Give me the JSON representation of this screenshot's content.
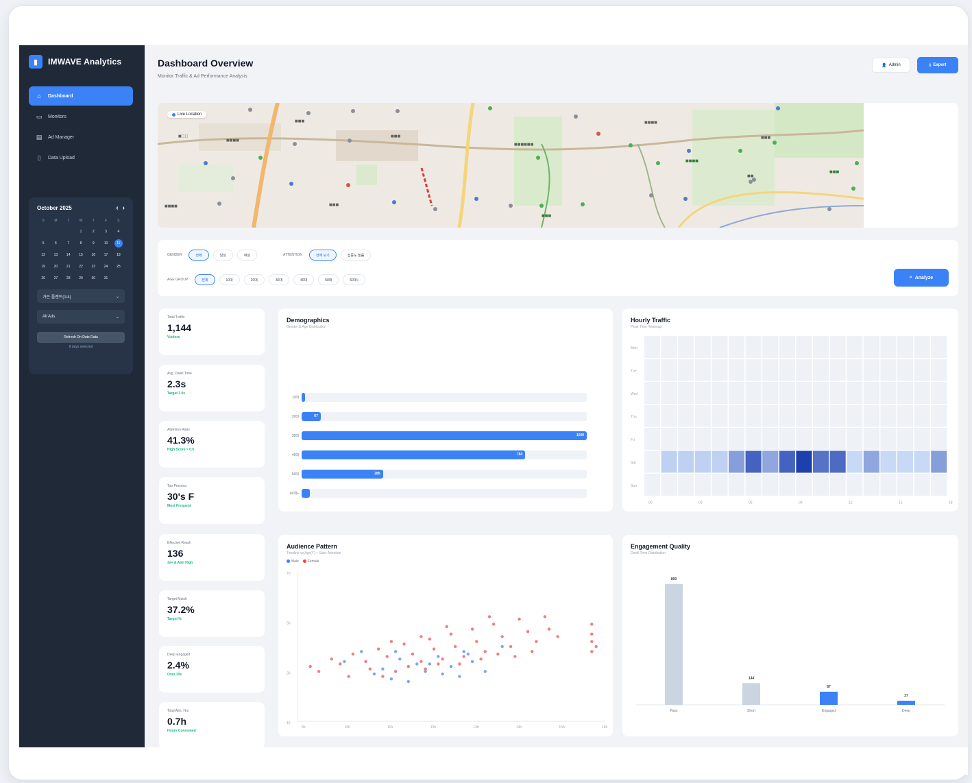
{
  "brand": {
    "name": "IMWAVE Analytics",
    "logo": "bar-chart-icon"
  },
  "nav": [
    {
      "label": "Dashboard",
      "icon": "home-icon",
      "active": true
    },
    {
      "label": "Monitors",
      "icon": "monitor-icon",
      "active": false
    },
    {
      "label": "Ad Manager",
      "icon": "ad-icon",
      "active": false
    },
    {
      "label": "Data Upload",
      "icon": "file-icon",
      "active": false
    }
  ],
  "calendar": {
    "month": "October 2025",
    "weekdays": [
      "S",
      "M",
      "T",
      "W",
      "T",
      "F",
      "S"
    ],
    "leading_blanks": 3,
    "days": 31,
    "selected_day": 11,
    "select1": "가든 플랜트(1/4)",
    "select2": "All Ads",
    "button": "Refresh On Date Data",
    "note": "8 days selected"
  },
  "header": {
    "title": "Dashboard Overview",
    "subtitle": "Monitor Traffic & Ad Performance Analysis",
    "admin": "Admin",
    "export": "Export"
  },
  "map": {
    "badge": "Live Location"
  },
  "filters": {
    "gender_label": "Gender",
    "gender": [
      {
        "label": "전체",
        "on": true
      },
      {
        "label": "남성",
        "on": false
      },
      {
        "label": "여성",
        "on": false
      }
    ],
    "attention_label": "Attention",
    "attention": [
      {
        "label": "전체 보기",
        "on": true
      },
      {
        "label": "집중도 높음",
        "on": false
      }
    ],
    "age_label": "Age Group",
    "age": [
      {
        "label": "전체",
        "on": true
      },
      {
        "label": "10대",
        "on": false
      },
      {
        "label": "20대",
        "on": false
      },
      {
        "label": "30대",
        "on": false
      },
      {
        "label": "40대",
        "on": false
      },
      {
        "label": "50대",
        "on": false
      },
      {
        "label": "60대+",
        "on": false
      }
    ],
    "analyze": "Analyze"
  },
  "kpis": [
    {
      "label": "Total Traffic",
      "value": "1,144",
      "sub": "Visitors"
    },
    {
      "label": "Avg. Dwell Time",
      "value": "2.3s",
      "sub": "Target 3.0s"
    },
    {
      "label": "Attention Ratio",
      "value": "41.3%",
      "sub": "High Score > 0.5"
    },
    {
      "label": "Top Persona",
      "value": "30's F",
      "sub": "Most Frequent"
    },
    {
      "label": "Effective Reach",
      "value": "136",
      "sub": "3s+ & Attn High"
    },
    {
      "label": "Target Match",
      "value": "37.2%",
      "sub": "Target %"
    },
    {
      "label": "Deep Engaged",
      "value": "2.4%",
      "sub": "Over 10s"
    },
    {
      "label": "Total Attn. Hrs",
      "value": "0.7h",
      "sub": "Hours Consumed"
    }
  ],
  "colors": {
    "accent": "#3b82f6",
    "male": "#3b82f6",
    "female": "#ef4444",
    "positive": "#10b981",
    "sidebar": "#1f2937"
  },
  "demographics": {
    "title": "Demographics",
    "subtitle": "Gender & Age Distribution",
    "chart_data": {
      "type": "bar",
      "orientation": "horizontal",
      "categories": [
        "10대",
        "20대",
        "30대",
        "40대",
        "50대",
        "60대+"
      ],
      "values": [
        3,
        67,
        1000,
        784,
        285,
        29
      ],
      "xlim": [
        0,
        1000
      ]
    }
  },
  "hourly": {
    "title": "Hourly Traffic",
    "subtitle": "Peak Time Heatmap",
    "chart_data": {
      "type": "heatmap",
      "rows": [
        "Mon",
        "Tue",
        "Wed",
        "Thu",
        "Fri",
        "Sat",
        "Sun"
      ],
      "columns": 18,
      "x_tick_labels": [
        "00",
        "03",
        "06",
        "09",
        "12",
        "15",
        "18"
      ],
      "values": [
        [
          0,
          0,
          0,
          0,
          0,
          0,
          0,
          0,
          0,
          0,
          0,
          0,
          0,
          0,
          0,
          0,
          0,
          0
        ],
        [
          0,
          0,
          0,
          0,
          0,
          0,
          0,
          0,
          0,
          0,
          0,
          0,
          0,
          0,
          0,
          0,
          0,
          0
        ],
        [
          0,
          0,
          0,
          0,
          0,
          0,
          0,
          0,
          0,
          0,
          0,
          0,
          0,
          0,
          0,
          0,
          0,
          0
        ],
        [
          0,
          0,
          0,
          0,
          0,
          0,
          0,
          0,
          0,
          0,
          0,
          0,
          0,
          0,
          0,
          0,
          0,
          0
        ],
        [
          0,
          0,
          0,
          0,
          0,
          0,
          0,
          0,
          0,
          0,
          0,
          0,
          0,
          0,
          0,
          0,
          0,
          0
        ],
        [
          0,
          0.15,
          0.15,
          0.15,
          0.15,
          0.45,
          0.8,
          0.4,
          0.8,
          1.0,
          0.7,
          0.75,
          0.1,
          0.4,
          0.1,
          0.1,
          0.1,
          0.45
        ],
        [
          0,
          0,
          0,
          0,
          0,
          0,
          0,
          0,
          0,
          0,
          0,
          0,
          0,
          0,
          0,
          0,
          0,
          0
        ]
      ]
    }
  },
  "audience": {
    "title": "Audience Pattern",
    "subtitle": "Timeline vs Age(Y) + Size: Attention",
    "legend": [
      {
        "label": "Male",
        "color": "#3b82f6"
      },
      {
        "label": "Female",
        "color": "#ef4444"
      }
    ],
    "chart_data": {
      "type": "scatter",
      "y_tick_labels": [
        "70",
        "50",
        "30",
        "10"
      ],
      "x_tick_labels": [
        "9h",
        "10h",
        "11h",
        "12h",
        "13h",
        "14h",
        "15h",
        "16h"
      ],
      "series": [
        {
          "name": "Male",
          "points": [
            [
              10.1,
              34
            ],
            [
              10.5,
              38
            ],
            [
              11.0,
              31
            ],
            [
              11.2,
              27
            ],
            [
              11.4,
              35
            ],
            [
              11.8,
              33
            ],
            [
              12.0,
              30
            ],
            [
              12.3,
              36
            ],
            [
              12.6,
              32
            ],
            [
              12.9,
              38
            ],
            [
              13.1,
              34
            ],
            [
              13.4,
              30
            ],
            [
              11.6,
              26
            ],
            [
              12.4,
              29
            ],
            [
              13.8,
              40
            ],
            [
              11.3,
              38
            ],
            [
              12.1,
              33
            ],
            [
              12.8,
              28
            ],
            [
              10.8,
              29
            ],
            [
              13.0,
              37
            ]
          ]
        },
        {
          "name": "Female",
          "points": [
            [
              9.3,
              32
            ],
            [
              9.5,
              30
            ],
            [
              9.8,
              35
            ],
            [
              10.0,
              33
            ],
            [
              10.3,
              37
            ],
            [
              10.6,
              34
            ],
            [
              10.9,
              39
            ],
            [
              11.1,
              36
            ],
            [
              11.3,
              30
            ],
            [
              11.5,
              41
            ],
            [
              11.7,
              37
            ],
            [
              11.9,
              34
            ],
            [
              12.1,
              43
            ],
            [
              12.2,
              39
            ],
            [
              12.4,
              35
            ],
            [
              12.6,
              45
            ],
            [
              12.7,
              40
            ],
            [
              12.9,
              36
            ],
            [
              13.1,
              47
            ],
            [
              13.2,
              42
            ],
            [
              13.4,
              38
            ],
            [
              13.6,
              49
            ],
            [
              13.8,
              44
            ],
            [
              14.0,
              40
            ],
            [
              14.2,
              51
            ],
            [
              14.4,
              46
            ],
            [
              14.6,
              42
            ],
            [
              14.9,
              47
            ],
            [
              15.1,
              44
            ],
            [
              15.9,
              38
            ],
            [
              15.9,
              42
            ],
            [
              15.9,
              45
            ],
            [
              15.9,
              49
            ],
            [
              16.0,
              40
            ],
            [
              10.2,
              28
            ],
            [
              10.7,
              31
            ],
            [
              11.0,
              28
            ],
            [
              11.6,
              32
            ],
            [
              12.0,
              31
            ],
            [
              12.3,
              33
            ],
            [
              12.8,
              33
            ],
            [
              13.3,
              35
            ],
            [
              13.7,
              37
            ],
            [
              14.1,
              36
            ],
            [
              14.5,
              38
            ],
            [
              14.8,
              52
            ],
            [
              13.5,
              52
            ],
            [
              12.5,
              48
            ],
            [
              11.9,
              44
            ],
            [
              11.2,
              42
            ]
          ]
        }
      ]
    }
  },
  "engagement": {
    "title": "Engagement Quality",
    "subtitle": "Dwell Time Distribution",
    "chart_data": {
      "type": "bar",
      "categories": [
        "Pass",
        "Short",
        "Engaged",
        "Deep"
      ],
      "values": [
        800,
        144,
        87,
        27
      ],
      "ylim": [
        0,
        800
      ]
    }
  }
}
